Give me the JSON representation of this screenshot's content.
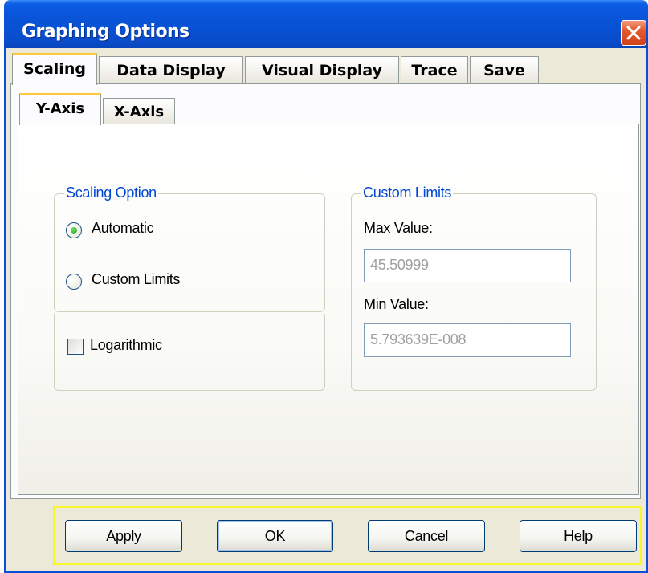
{
  "window": {
    "title": "Graphing Options"
  },
  "tabs": [
    "Scaling",
    "Data Display",
    "Visual Display",
    "Trace",
    "Save"
  ],
  "active_tab": "Scaling",
  "axis_tabs": [
    "Y-Axis",
    "X-Axis"
  ],
  "active_axis_tab": "Y-Axis",
  "scaling_option": {
    "legend": "Scaling Option",
    "options": [
      "Automatic",
      "Custom Limits"
    ],
    "selected": "Automatic",
    "logarithmic_label": "Logarithmic",
    "logarithmic_checked": false
  },
  "custom_limits": {
    "legend": "Custom Limits",
    "max_label": "Max Value:",
    "max_value": "45.50999",
    "min_label": "Min Value:",
    "min_value": "5.793639E-008"
  },
  "buttons": {
    "apply": "Apply",
    "ok": "OK",
    "cancel": "Cancel",
    "help": "Help"
  },
  "colors": {
    "titlebar": "#0a55da",
    "legend_text": "#0046d5",
    "active_tab_accent": "#ffc83c",
    "radio_selected": "#21a121",
    "button_bar_highlight": "#f7f72a"
  }
}
